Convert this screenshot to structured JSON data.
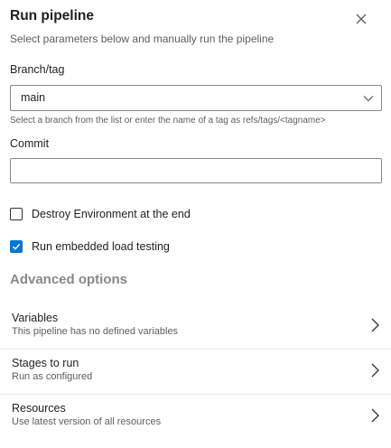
{
  "header": {
    "title": "Run pipeline",
    "subtitle": "Select parameters below and manually run the pipeline",
    "close_icon": "close-icon"
  },
  "branch": {
    "label": "Branch/tag",
    "value": "main",
    "hint": "Select a branch from the list or enter the name of a tag as refs/tags/<tagname>",
    "icon": "chevron-down-icon"
  },
  "commit": {
    "label": "Commit",
    "value": "",
    "placeholder": ""
  },
  "options": [
    {
      "label": "Destroy Environment at the end",
      "checked": false
    },
    {
      "label": "Run embedded load testing",
      "checked": true
    }
  ],
  "advanced": {
    "title": "Advanced options",
    "items": [
      {
        "title": "Variables",
        "subtitle": "This pipeline has no defined variables",
        "icon": "chevron-right-icon"
      },
      {
        "title": "Stages to run",
        "subtitle": "Run as configured",
        "icon": "chevron-right-icon"
      },
      {
        "title": "Resources",
        "subtitle": "Use latest version of all resources",
        "icon": "chevron-right-icon"
      }
    ]
  },
  "colors": {
    "accent": "#0078d4",
    "text": "#201f1e",
    "muted": "#605e5c",
    "border": "#8a8886"
  }
}
